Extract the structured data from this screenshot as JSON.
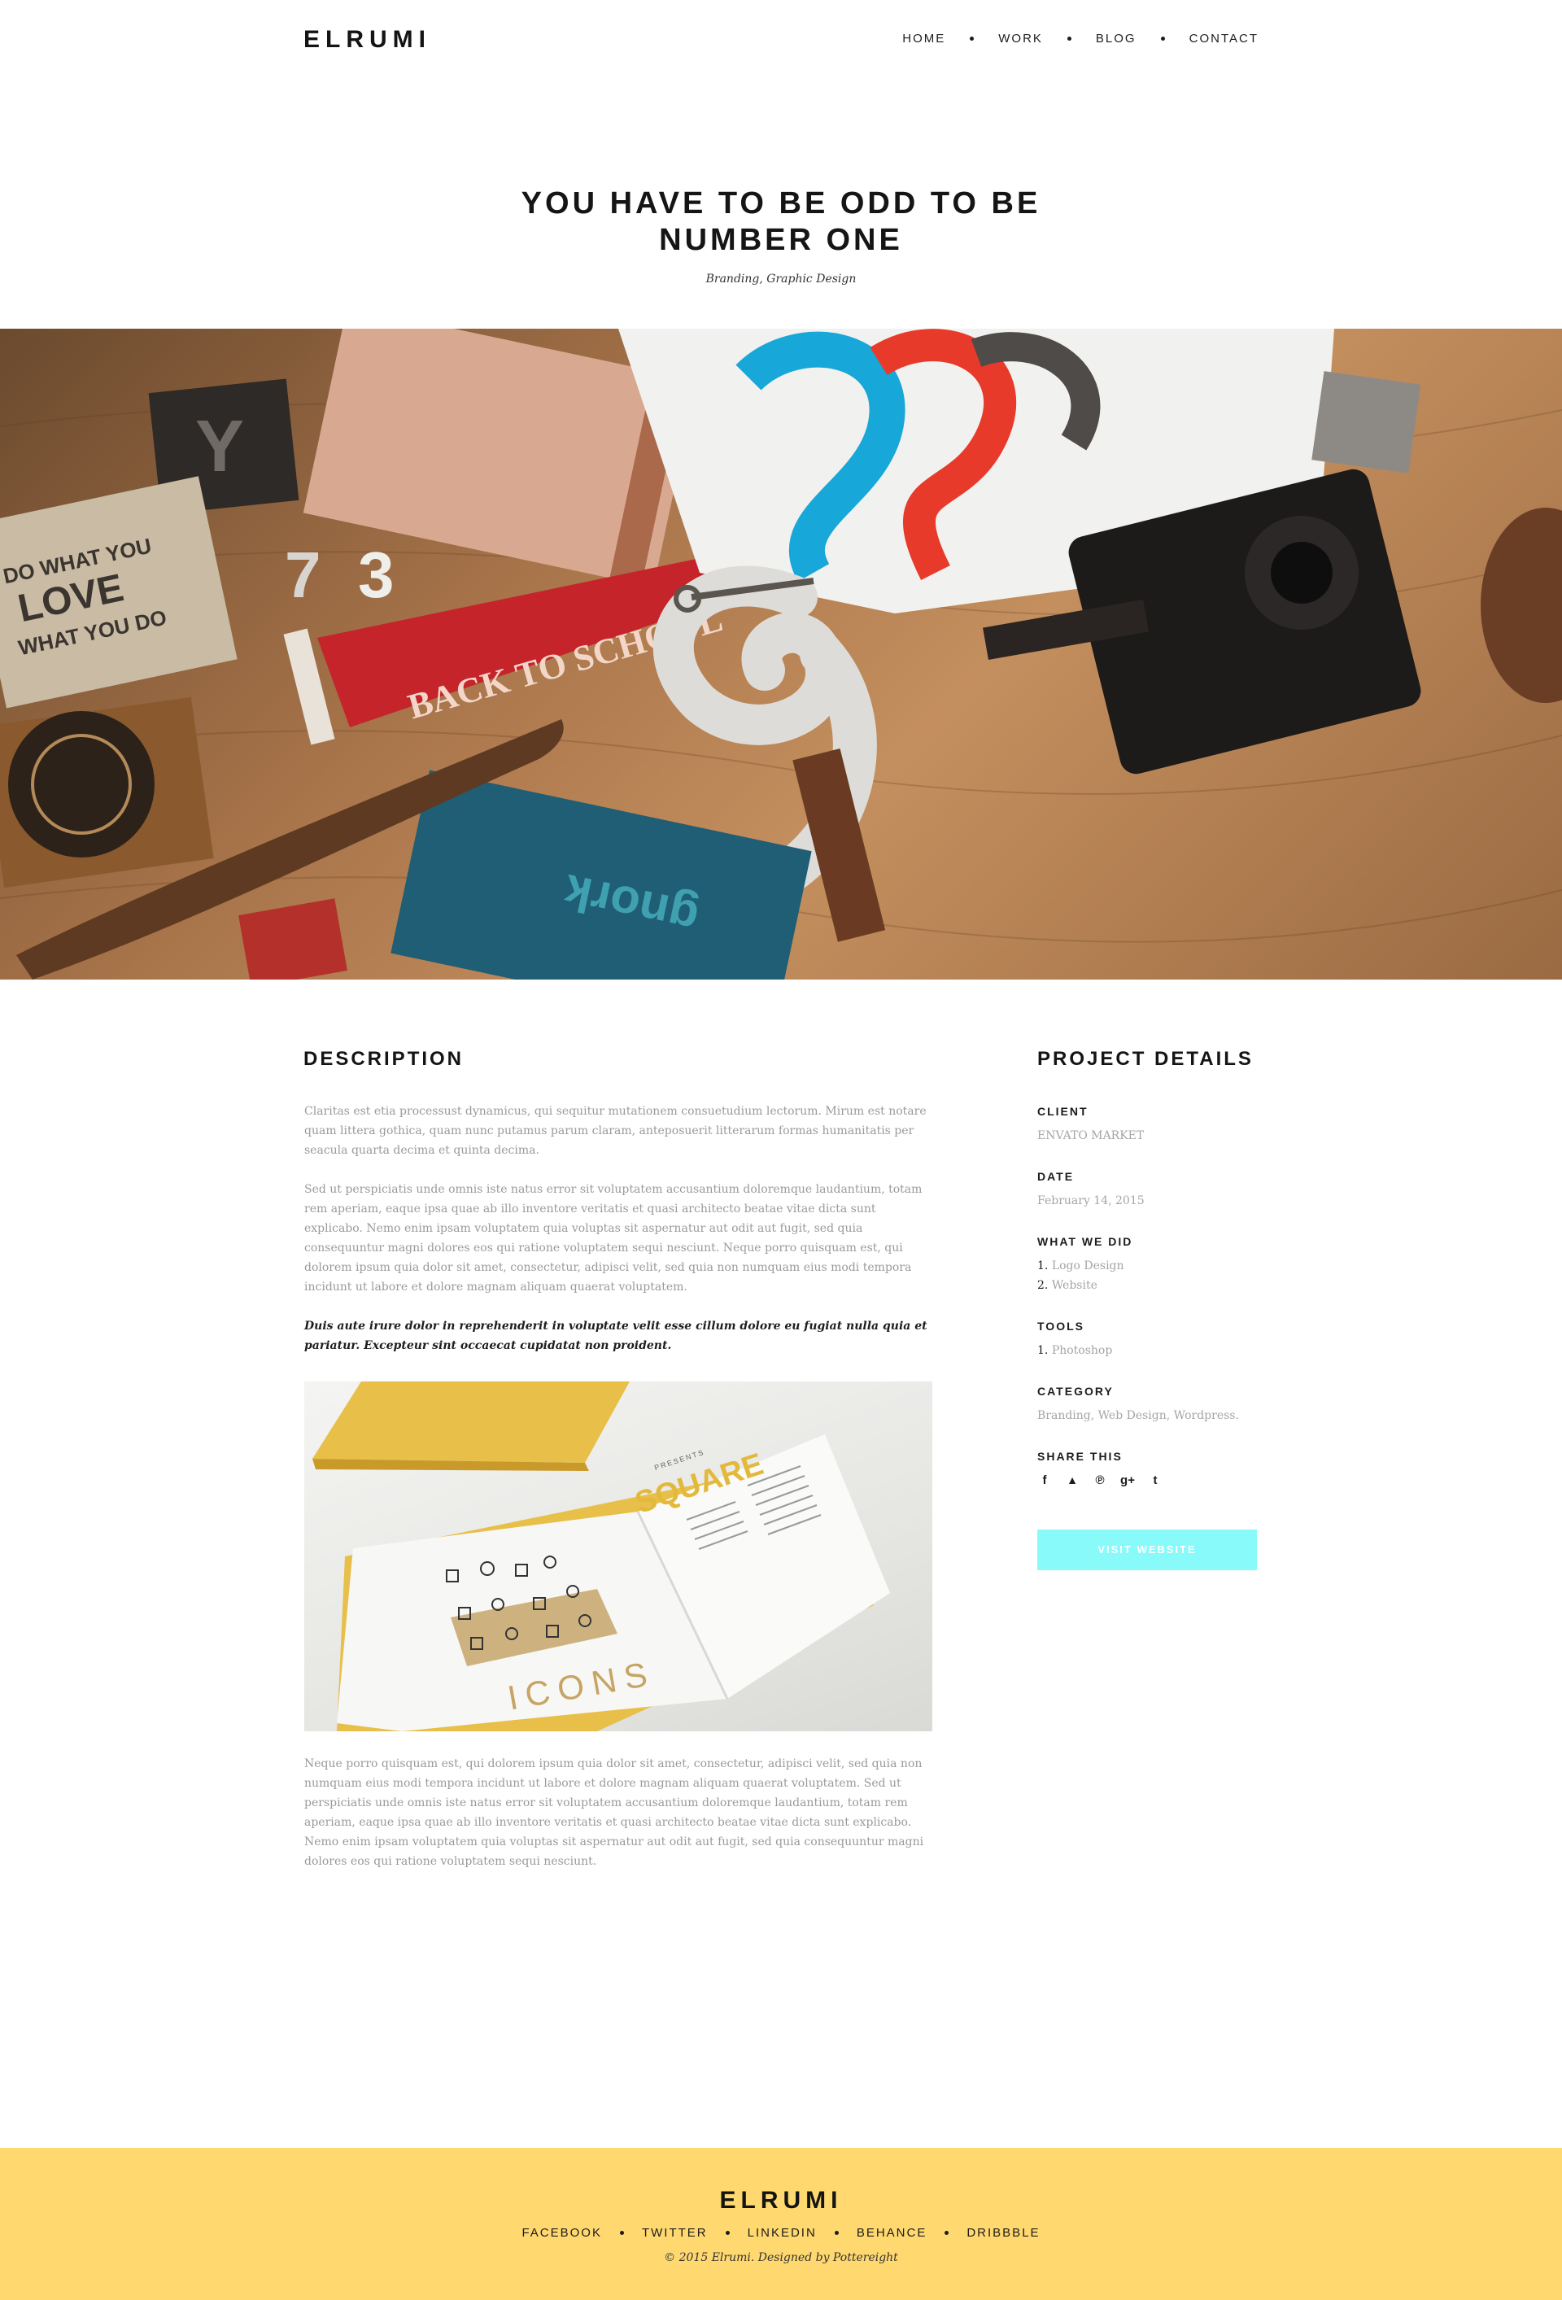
{
  "brand": "ELRUMI",
  "nav": {
    "items": [
      {
        "label": "HOME"
      },
      {
        "label": "WORK"
      },
      {
        "label": "BLOG"
      },
      {
        "label": "CONTACT"
      }
    ]
  },
  "project": {
    "title_line1": "YOU HAVE TO BE ODD TO BE",
    "title_line2": "NUMBER ONE",
    "subtitle": "Branding, Graphic Design"
  },
  "description": {
    "heading": "DESCRIPTION",
    "p1": "Claritas est etia processust dynamicus, qui sequitur mutationem consuetudium lectorum. Mirum est notare quam littera gothica, quam nunc putamus parum claram, anteposuerit litterarum formas humanitatis per seacula quarta decima et quinta decima.",
    "p2": "Sed ut perspiciatis unde omnis iste natus error sit voluptatem accusantium doloremque laudantium, totam rem aperiam, eaque ipsa quae ab illo inventore veritatis et quasi architecto beatae vitae dicta sunt explicabo. Nemo enim ipsam voluptatem quia voluptas sit aspernatur aut odit aut fugit, sed quia consequuntur magni dolores eos qui ratione voluptatem sequi nesciunt. Neque porro quisquam est, qui dolorem ipsum quia dolor sit amet, consectetur, adipisci velit, sed quia non numquam eius modi tempora incidunt ut labore et dolore magnam aliquam quaerat voluptatem.",
    "p3": "Duis aute irure dolor in reprehenderit in voluptate velit esse cillum dolore eu fugiat nulla quia et pariatur. Excepteur sint occaecat cupidatat non proident.",
    "p4": "Neque porro quisquam est, qui dolorem ipsum quia dolor sit amet, consectetur, adipisci velit, sed quia non numquam eius modi tempora incidunt ut labore et dolore magnam aliquam quaerat voluptatem. Sed ut perspiciatis unde omnis iste natus error sit voluptatem accusantium doloremque laudantium, totam rem aperiam, eaque ipsa quae ab illo inventore veritatis et quasi architecto beatae vitae dicta sunt explicabo. Nemo enim ipsam voluptatem quia voluptas sit aspernatur aut odit aut fugit, sed quia consequuntur magni dolores eos qui ratione voluptatem sequi nesciunt.",
    "book_text_square": "SQUARE",
    "book_text_icons": "ICONS",
    "book_text_presents": "PRESENTS"
  },
  "details": {
    "heading": "PROJECT DETAILS",
    "client_label": "CLIENT",
    "client_value": "ENVATO MARKET",
    "date_label": "DATE",
    "date_value": "February 14, 2015",
    "what_label": "WHAT WE DID",
    "what_items": [
      {
        "num": "1.",
        "text": "Logo Design"
      },
      {
        "num": "2.",
        "text": "Website"
      }
    ],
    "tools_label": "TOOLS",
    "tools_items": [
      {
        "num": "1.",
        "text": "Photoshop"
      }
    ],
    "category_label": "CATEGORY",
    "category_value": "Branding, Web Design, Wordpress.",
    "share_label": "SHARE THIS",
    "share_icons": [
      "facebook-icon",
      "twitter-icon",
      "pinterest-icon",
      "google-plus-icon",
      "tumblr-icon"
    ],
    "share_glyphs": [
      "f",
      "🐦",
      "℗",
      "g+",
      "t"
    ],
    "visit_label": "VISIT WEBSITE"
  },
  "footer": {
    "brand": "ELRUMI",
    "links": [
      {
        "label": "FACEBOOK"
      },
      {
        "label": "TWITTER"
      },
      {
        "label": "LINKEDIN"
      },
      {
        "label": "BEHANCE"
      },
      {
        "label": "DRIBBBLE"
      }
    ],
    "copyright": "© 2015 Elrumi. Designed by Pottereight"
  },
  "hero_image_text": {
    "pennant": "BACK TO SCHOOL",
    "book_line1": "DO WHAT YOU",
    "book_line2": "LOVE",
    "book_line3": "WHAT YOU DO",
    "blue_book": "gnork"
  },
  "colors": {
    "accent_cyan": "#88fafa",
    "footer_yellow": "#ffd86f",
    "text_muted": "#9a9a9a"
  }
}
